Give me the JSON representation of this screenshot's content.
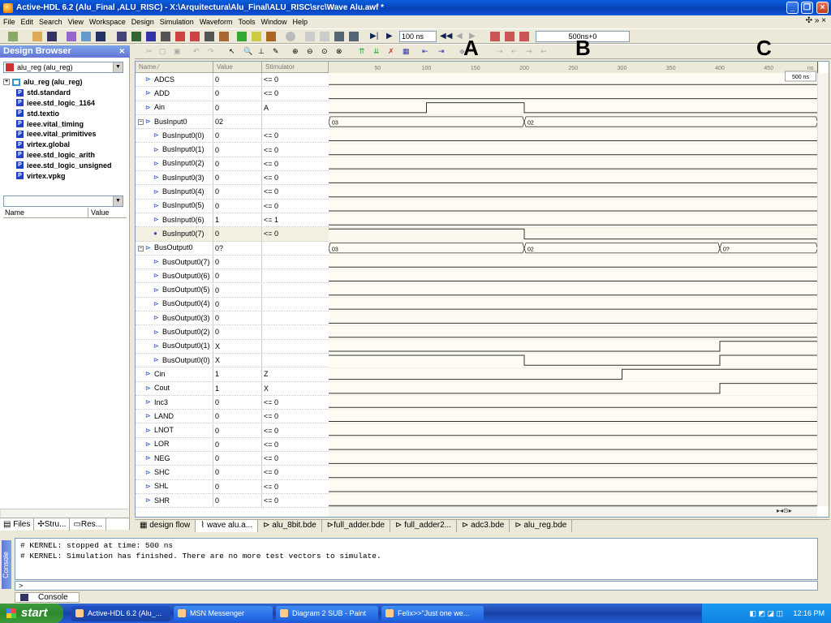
{
  "title": "Active-HDL 6.2 (Alu_Final ,ALU_RISC) - X:\\Arquitectura\\Alu_Final\\ALU_RISC\\src\\Wave Alu.awf *",
  "menu": [
    "File",
    "Edit",
    "Search",
    "View",
    "Workspace",
    "Design",
    "Simulation",
    "Waveform",
    "Tools",
    "Window",
    "Help"
  ],
  "toolbar": {
    "time_step": "100 ns",
    "cursor_time": "500ns+0"
  },
  "annotations": [
    "A",
    "B",
    "C"
  ],
  "design_browser": {
    "title": "Design Browser",
    "selected": "alu_reg (alu_reg)",
    "root": "alu_reg (alu_reg)",
    "libraries": [
      "std.standard",
      "ieee.std_logic_1164",
      "std.textio",
      "ieee.vital_timing",
      "ieee.vital_primitives",
      "virtex.global",
      "ieee.std_logic_arith",
      "ieee.std_logic_unsigned",
      "virtex.vpkg"
    ],
    "columns": {
      "name": "Name",
      "value": "Value"
    },
    "tabs": [
      "Files",
      "Stru...",
      "Res..."
    ]
  },
  "wave": {
    "columns": {
      "name": "Name ⁄",
      "value": "Value",
      "stimulator": "Stimulator"
    },
    "ruler": [
      "50",
      "100",
      "150",
      "200",
      "250",
      "300",
      "350",
      "400",
      "450"
    ],
    "ruler_unit": "ns",
    "cursor_label": "500 ns",
    "signals": [
      {
        "name": "ADCS",
        "value": "0",
        "stim": "<= 0",
        "level": 0
      },
      {
        "name": "ADD",
        "value": "0",
        "stim": "<= 0",
        "level": 0
      },
      {
        "name": "Ain",
        "value": "0",
        "stim": "A",
        "level": 0
      },
      {
        "name": "BusInput0",
        "value": "02",
        "stim": "",
        "level": 0,
        "group": true
      },
      {
        "name": "BusInput0(0)",
        "value": "0",
        "stim": "<= 0",
        "level": 1
      },
      {
        "name": "BusInput0(1)",
        "value": "0",
        "stim": "<= 0",
        "level": 1
      },
      {
        "name": "BusInput0(2)",
        "value": "0",
        "stim": "<= 0",
        "level": 1
      },
      {
        "name": "BusInput0(3)",
        "value": "0",
        "stim": "<= 0",
        "level": 1
      },
      {
        "name": "BusInput0(4)",
        "value": "0",
        "stim": "<= 0",
        "level": 1
      },
      {
        "name": "BusInput0(5)",
        "value": "0",
        "stim": "<= 0",
        "level": 1
      },
      {
        "name": "BusInput0(6)",
        "value": "1",
        "stim": "<= 1",
        "level": 1
      },
      {
        "name": "BusInput0(7)",
        "value": "0",
        "stim": "<= 0",
        "level": 1,
        "selected": true
      },
      {
        "name": "BusOutput0",
        "value": "0?",
        "stim": "",
        "level": 0,
        "group": true
      },
      {
        "name": "BusOutput0(7)",
        "value": "0",
        "stim": "",
        "level": 1
      },
      {
        "name": "BusOutput0(6)",
        "value": "0",
        "stim": "",
        "level": 1
      },
      {
        "name": "BusOutput0(5)",
        "value": "0",
        "stim": "",
        "level": 1
      },
      {
        "name": "BusOutput0(4)",
        "value": "0",
        "stim": "",
        "level": 1
      },
      {
        "name": "BusOutput0(3)",
        "value": "0",
        "stim": "",
        "level": 1
      },
      {
        "name": "BusOutput0(2)",
        "value": "0",
        "stim": "",
        "level": 1
      },
      {
        "name": "BusOutput0(1)",
        "value": "X",
        "stim": "",
        "level": 1
      },
      {
        "name": "BusOutput0(0)",
        "value": "X",
        "stim": "",
        "level": 1
      },
      {
        "name": "Cin",
        "value": "1",
        "stim": "Z",
        "level": 0
      },
      {
        "name": "Cout",
        "value": "1",
        "stim": "X",
        "level": 0
      },
      {
        "name": "Inc3",
        "value": "0",
        "stim": "<= 0",
        "level": 0
      },
      {
        "name": "LAND",
        "value": "0",
        "stim": "<= 0",
        "level": 0
      },
      {
        "name": "LNOT",
        "value": "0",
        "stim": "<= 0",
        "level": 0
      },
      {
        "name": "LOR",
        "value": "0",
        "stim": "<= 0",
        "level": 0
      },
      {
        "name": "NEG",
        "value": "0",
        "stim": "<= 0",
        "level": 0
      },
      {
        "name": "SHC",
        "value": "0",
        "stim": "<= 0",
        "level": 0
      },
      {
        "name": "SHL",
        "value": "0",
        "stim": "<= 0",
        "level": 0
      },
      {
        "name": "SHR",
        "value": "0",
        "stim": "<= 0",
        "level": 0
      }
    ],
    "bus_labels": {
      "BusInput0": [
        "03",
        "02"
      ],
      "BusOutput0": [
        "03",
        "02",
        "0?"
      ]
    }
  },
  "doc_tabs": [
    "design flow",
    "wave alu.a...",
    "alu_8bit.bde",
    "full_adder.bde",
    "full_adder2...",
    "adc3.bde",
    "alu_reg.bde"
  ],
  "console": {
    "lines": [
      "# KERNEL: stopped at time: 500 ns",
      "# KERNEL: Simulation has finished. There are no more test vectors to simulate."
    ],
    "prompt": ">",
    "tab": "Console",
    "side_label": "Console"
  },
  "taskbar": {
    "start": "start",
    "tasks": [
      "Active-HDL 6.2 (Alu_...",
      "MSN Messenger",
      "Diagram 2 SUB - Paint",
      "Felix>>\"Just one we..."
    ],
    "clock": "12:16 PM"
  }
}
